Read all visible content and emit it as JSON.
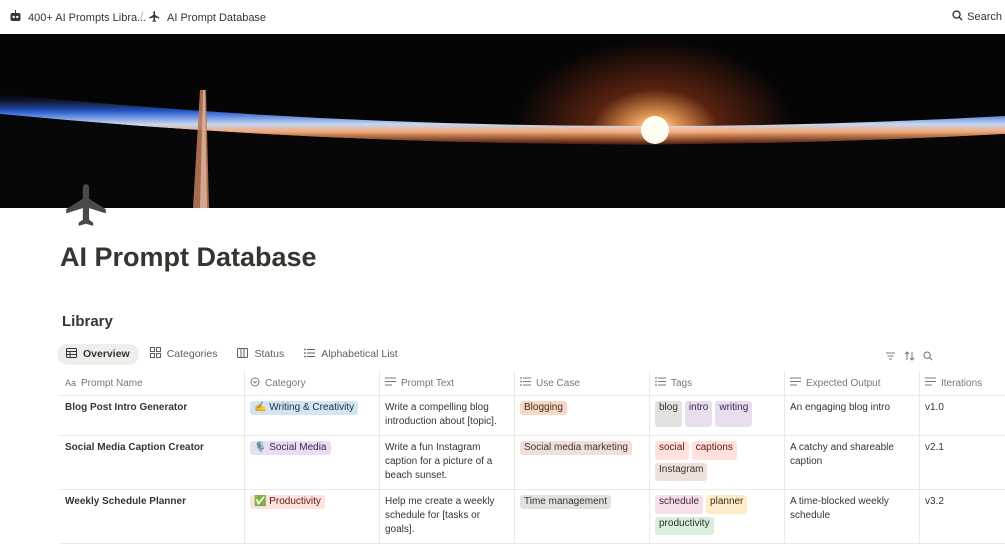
{
  "topbar": {
    "crumb1_label": "400+ AI Prompts Libra...",
    "crumb2_label": "AI Prompt Database",
    "search_label": "Search"
  },
  "page": {
    "title": "AI Prompt Database",
    "icon": "airplane-icon"
  },
  "library": {
    "title": "Library",
    "views": [
      {
        "label": "Overview",
        "icon": "table-icon"
      },
      {
        "label": "Categories",
        "icon": "gallery-icon"
      },
      {
        "label": "Status",
        "icon": "board-icon"
      },
      {
        "label": "Alphabetical List",
        "icon": "list-icon"
      }
    ],
    "columns": [
      {
        "label": "Prompt Name",
        "icon": "Aa"
      },
      {
        "label": "Category",
        "icon": "select-icon"
      },
      {
        "label": "Prompt Text",
        "icon": "text-icon"
      },
      {
        "label": "Use Case",
        "icon": "list-icon"
      },
      {
        "label": "Tags",
        "icon": "list-icon"
      },
      {
        "label": "Expected Output",
        "icon": "text-icon"
      },
      {
        "label": "Iterations",
        "icon": "text-icon"
      }
    ],
    "rows": [
      {
        "name": "Blog Post Intro Generator",
        "category": {
          "emoji": "✍️",
          "label": "Writing & Creativity",
          "color": "#d3e5ef"
        },
        "prompt_text": "Write a compelling blog introduction about [topic].",
        "use_case": {
          "label": "Blogging",
          "color": "#f5d9c8"
        },
        "tags": [
          {
            "label": "blog",
            "color": "#e3e2e0"
          },
          {
            "label": "intro",
            "color": "#e8deee"
          },
          {
            "label": "writing",
            "color": "#e8deee"
          }
        ],
        "expected_output": "An engaging blog intro",
        "iterations": "v1.0"
      },
      {
        "name": "Social Media Caption Creator",
        "category": {
          "emoji": "🎙️",
          "label": "Social Media",
          "color": "#e8deee"
        },
        "prompt_text": "Write a fun Instagram caption for a picture of a beach sunset.",
        "use_case": {
          "label": "Social media marketing",
          "color": "#eee0da"
        },
        "tags": [
          {
            "label": "social",
            "color": "#ffe2dd"
          },
          {
            "label": "captions",
            "color": "#ffe2dd"
          },
          {
            "label": "Instagram",
            "color": "#eee0da"
          }
        ],
        "expected_output": "A catchy and shareable caption",
        "iterations": "v2.1"
      },
      {
        "name": "Weekly Schedule Planner",
        "category": {
          "emoji": "✅",
          "label": "Productivity",
          "color": "#ffe2dd"
        },
        "prompt_text": "Help me create a weekly schedule for [tasks or goals].",
        "use_case": {
          "label": "Time management",
          "color": "#e3e2e0"
        },
        "tags": [
          {
            "label": "schedule",
            "color": "#f5e0e9"
          },
          {
            "label": "planner",
            "color": "#fdecc8"
          },
          {
            "label": "productivity",
            "color": "#dbeddb"
          }
        ],
        "expected_output": "A time-blocked weekly schedule",
        "iterations": "v3.2"
      }
    ]
  }
}
